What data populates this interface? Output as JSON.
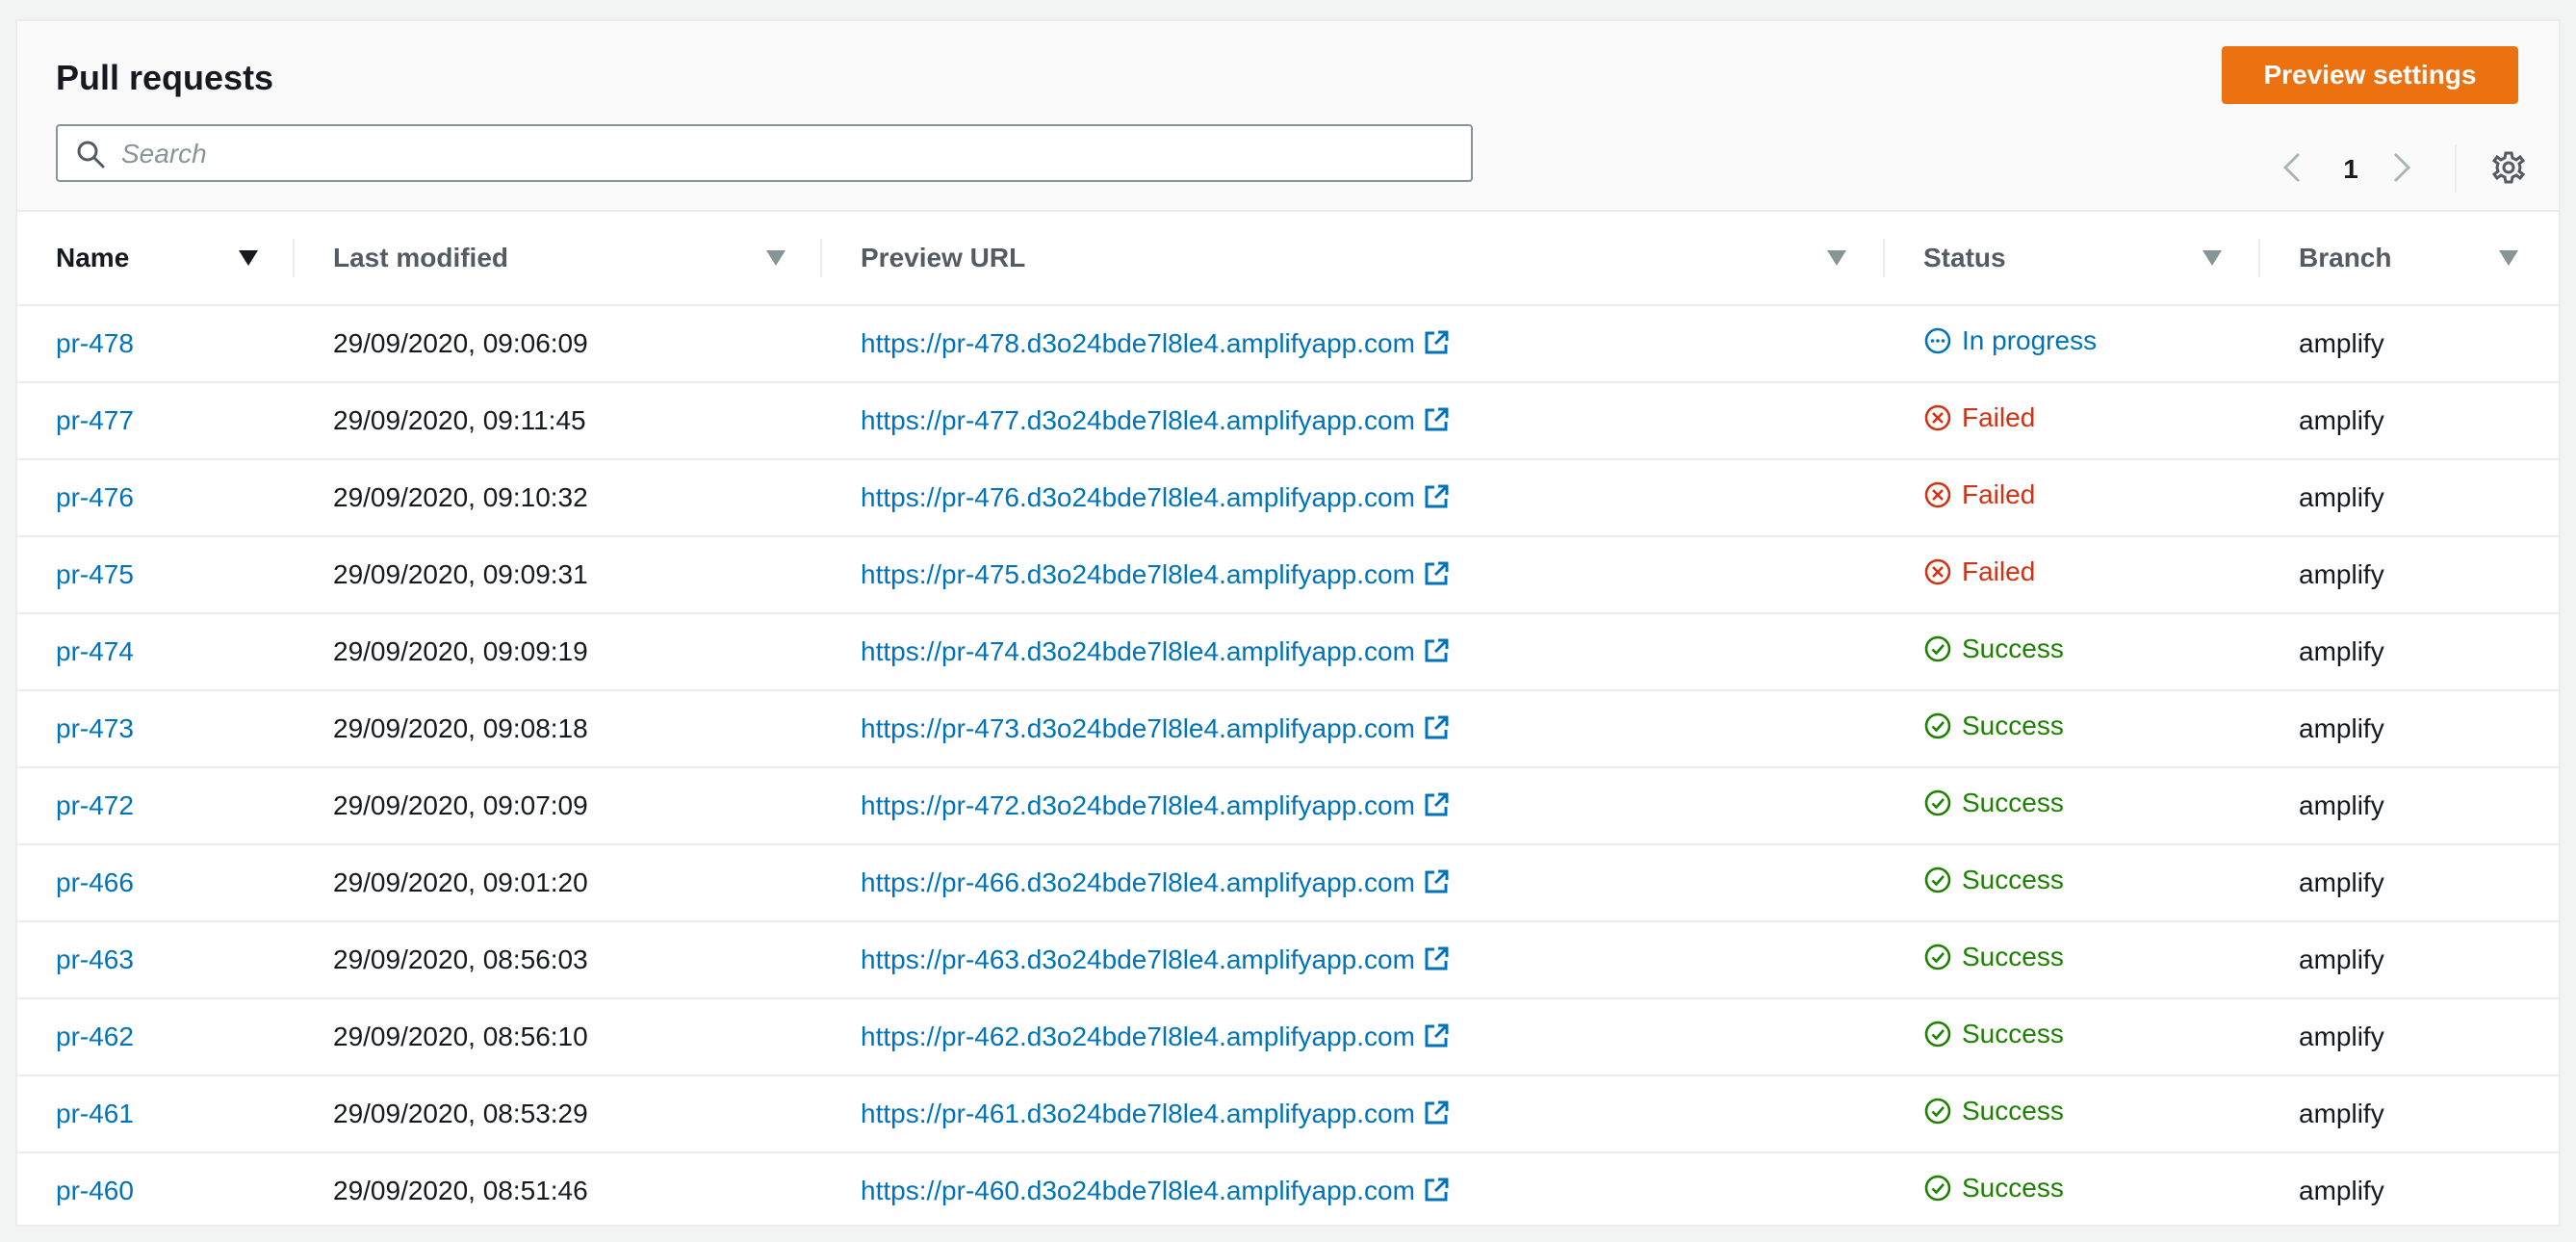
{
  "header": {
    "title": "Pull requests",
    "preview_settings_label": "Preview settings",
    "search_placeholder": "Search",
    "current_page": "1"
  },
  "columns": [
    "Name",
    "Last modified",
    "Preview URL",
    "Status",
    "Branch"
  ],
  "rows": [
    {
      "name": "pr-478",
      "modified": "29/09/2020, 09:06:09",
      "url": "https://pr-478.d3o24bde7l8le4.amplifyapp.com",
      "status": "In progress",
      "status_type": "progress",
      "branch": "amplify"
    },
    {
      "name": "pr-477",
      "modified": "29/09/2020, 09:11:45",
      "url": "https://pr-477.d3o24bde7l8le4.amplifyapp.com",
      "status": "Failed",
      "status_type": "failed",
      "branch": "amplify"
    },
    {
      "name": "pr-476",
      "modified": "29/09/2020, 09:10:32",
      "url": "https://pr-476.d3o24bde7l8le4.amplifyapp.com",
      "status": "Failed",
      "status_type": "failed",
      "branch": "amplify"
    },
    {
      "name": "pr-475",
      "modified": "29/09/2020, 09:09:31",
      "url": "https://pr-475.d3o24bde7l8le4.amplifyapp.com",
      "status": "Failed",
      "status_type": "failed",
      "branch": "amplify"
    },
    {
      "name": "pr-474",
      "modified": "29/09/2020, 09:09:19",
      "url": "https://pr-474.d3o24bde7l8le4.amplifyapp.com",
      "status": "Success",
      "status_type": "success",
      "branch": "amplify"
    },
    {
      "name": "pr-473",
      "modified": "29/09/2020, 09:08:18",
      "url": "https://pr-473.d3o24bde7l8le4.amplifyapp.com",
      "status": "Success",
      "status_type": "success",
      "branch": "amplify"
    },
    {
      "name": "pr-472",
      "modified": "29/09/2020, 09:07:09",
      "url": "https://pr-472.d3o24bde7l8le4.amplifyapp.com",
      "status": "Success",
      "status_type": "success",
      "branch": "amplify"
    },
    {
      "name": "pr-466",
      "modified": "29/09/2020, 09:01:20",
      "url": "https://pr-466.d3o24bde7l8le4.amplifyapp.com",
      "status": "Success",
      "status_type": "success",
      "branch": "amplify"
    },
    {
      "name": "pr-463",
      "modified": "29/09/2020, 08:56:03",
      "url": "https://pr-463.d3o24bde7l8le4.amplifyapp.com",
      "status": "Success",
      "status_type": "success",
      "branch": "amplify"
    },
    {
      "name": "pr-462",
      "modified": "29/09/2020, 08:56:10",
      "url": "https://pr-462.d3o24bde7l8le4.amplifyapp.com",
      "status": "Success",
      "status_type": "success",
      "branch": "amplify"
    },
    {
      "name": "pr-461",
      "modified": "29/09/2020, 08:53:29",
      "url": "https://pr-461.d3o24bde7l8le4.amplifyapp.com",
      "status": "Success",
      "status_type": "success",
      "branch": "amplify"
    },
    {
      "name": "pr-460",
      "modified": "29/09/2020, 08:51:46",
      "url": "https://pr-460.d3o24bde7l8le4.amplifyapp.com",
      "status": "Success",
      "status_type": "success",
      "branch": "amplify"
    }
  ],
  "icons": {
    "search": "search-icon",
    "prev": "chevron-left-icon",
    "next": "chevron-right-icon",
    "settings": "gear-icon",
    "external": "external-link-icon",
    "sort": "caret-down-icon"
  },
  "colors": {
    "primary_button": "#ec7211",
    "link": "#0073bb",
    "failed": "#d13212",
    "success": "#1d8102"
  }
}
